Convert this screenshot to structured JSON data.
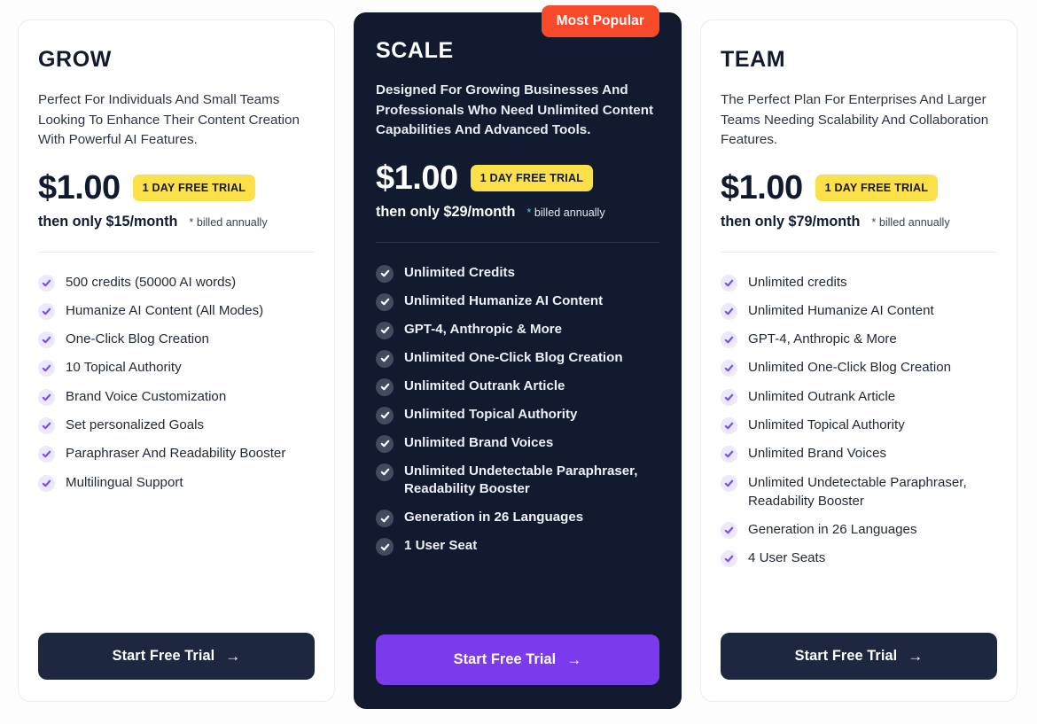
{
  "plans": [
    {
      "name": "GROW",
      "description": "Perfect For Individuals And Small Teams Looking To Enhance Their Content Creation With Powerful AI Features.",
      "price": "$1.00",
      "trial_badge": "1 DAY FREE TRIAL",
      "then_only": "then only $15/month",
      "billed_star": "*",
      "billed_note": "billed annually",
      "features": [
        "500 credits (50000 AI words)",
        "Humanize AI Content (All Modes)",
        "One-Click Blog Creation",
        "10 Topical Authority",
        "Brand Voice Customization",
        "Set personalized Goals",
        "Paraphraser And Readability Booster",
        "Multilingual Support"
      ],
      "cta_label": "Start Free Trial",
      "cta_arrow": "→"
    },
    {
      "name": "SCALE",
      "popular_badge": "Most Popular",
      "description": "Designed For Growing Businesses And Professionals Who Need Unlimited Content Capabilities And Advanced Tools.",
      "price": "$1.00",
      "trial_badge": "1 DAY FREE TRIAL",
      "then_only": "then only $29/month",
      "billed_star": "*",
      "billed_note": "billed annually",
      "features": [
        "Unlimited Credits",
        "Unlimited Humanize AI Content",
        "GPT-4, Anthropic & More",
        "Unlimited One-Click Blog Creation",
        "Unlimited Outrank Article",
        "Unlimited Topical Authority",
        "Unlimited Brand Voices",
        "Unlimited Undetectable Paraphraser, Readability Booster",
        "Generation in 26 Languages",
        "1 User Seat"
      ],
      "cta_label": "Start Free Trial",
      "cta_arrow": "→"
    },
    {
      "name": "TEAM",
      "description": "The Perfect Plan For Enterprises And Larger Teams Needing Scalability And Collaboration Features.",
      "price": "$1.00",
      "trial_badge": "1 DAY FREE TRIAL",
      "then_only": "then only $79/month",
      "billed_star": "*",
      "billed_note": "billed annually",
      "features": [
        "Unlimited credits",
        "Unlimited Humanize AI Content",
        "GPT-4, Anthropic & More",
        "Unlimited One-Click Blog Creation",
        "Unlimited Outrank Article",
        "Unlimited Topical Authority",
        "Unlimited Brand Voices",
        "Unlimited Undetectable Paraphraser, Readability Booster",
        "Generation in 26 Languages",
        "4 User Seats"
      ],
      "cta_label": "Start Free Trial",
      "cta_arrow": "→"
    }
  ],
  "colors": {
    "popular_badge": "#f9492b",
    "trial_badge": "#fbe04a",
    "dark_card": "#111a2e",
    "accent_purple": "#7c3aed",
    "cta_navy": "#1d273f",
    "check_light": "#ece8fd",
    "check_dark": "#414a5e",
    "star_cyan": "#3fd8e8"
  }
}
